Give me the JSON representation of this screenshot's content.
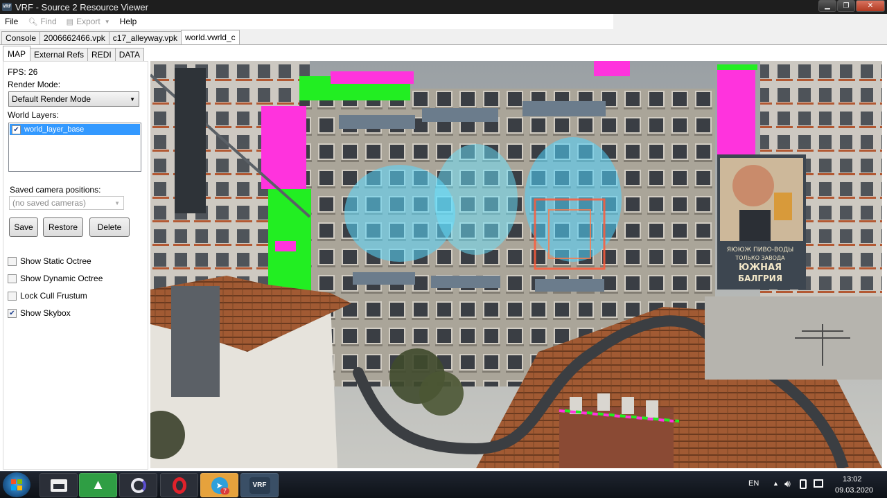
{
  "window": {
    "title": "VRF - Source 2 Resource Viewer",
    "app_icon_text": "VRF"
  },
  "menu": {
    "file": "File",
    "find": "Find",
    "export": "Export",
    "help": "Help"
  },
  "outer_tabs": [
    "Console",
    "2006662466.vpk",
    "c17_alleyway.vpk",
    "world.vwrld_c"
  ],
  "inner_tabs": [
    "MAP",
    "External Refs",
    "REDI",
    "DATA"
  ],
  "panel": {
    "fps": "FPS: 26",
    "render_mode_label": "Render Mode:",
    "render_mode_value": "Default Render Mode",
    "world_layers_label": "World Layers:",
    "layers": [
      {
        "name": "world_layer_base",
        "checked": true
      }
    ],
    "saved_cameras_label": "Saved camera positions:",
    "saved_cameras_value": "(no saved cameras)",
    "buttons": {
      "save": "Save",
      "restore": "Restore",
      "delete": "Delete"
    },
    "checkboxes": [
      {
        "label": "Show Static Octree",
        "checked": false
      },
      {
        "label": "Show Dynamic Octree",
        "checked": false
      },
      {
        "label": "Lock Cull Frustum",
        "checked": false
      },
      {
        "label": "Show Skybox",
        "checked": true
      }
    ]
  },
  "billboard": {
    "line1": "ЯЮЮЖ ПИВО-ВОДЫ",
    "line2": "ТОЛЬКО ЗАВОДА",
    "line3": "ЮЖНАЯ",
    "line4": "БАЛГРИЯ"
  },
  "taskbar": {
    "apps": [
      "file-explorer",
      "android-studio",
      "firefox",
      "opera",
      "telegram",
      "vrf"
    ],
    "telegram_badge": "7",
    "vrf_label": "VRF",
    "language": "EN",
    "time": "13:02",
    "date": "09.03.2020"
  },
  "colors": {
    "magenta": "#ff33dd",
    "green": "#22ee22",
    "selection": "#3399ff"
  }
}
